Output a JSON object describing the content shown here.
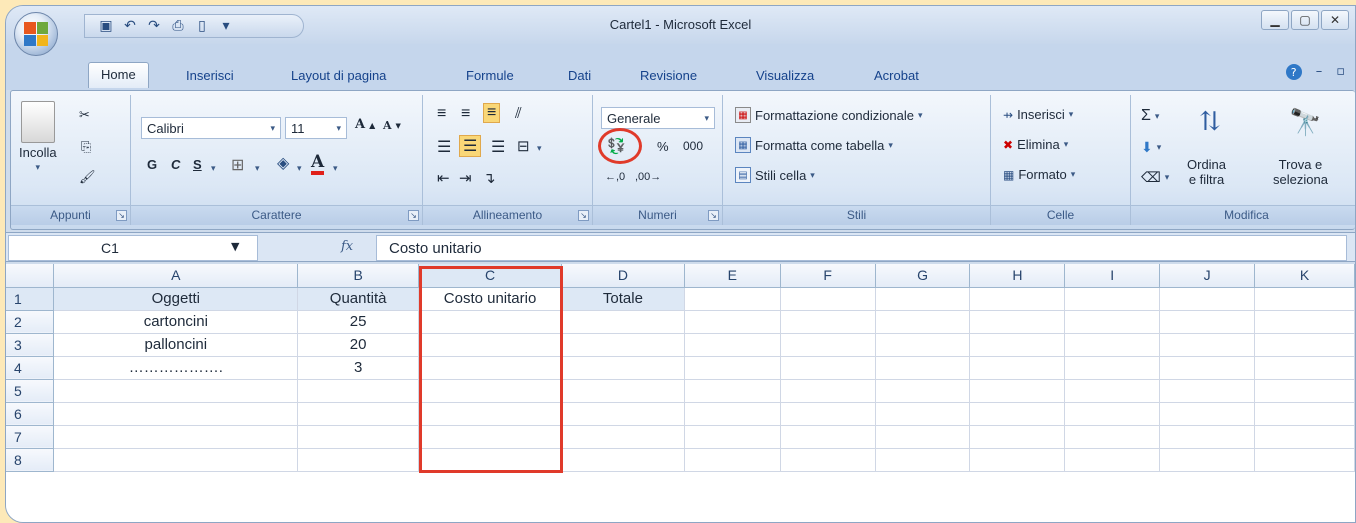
{
  "window": {
    "title": "Cartel1 - Microsoft Excel"
  },
  "tabs": [
    "Home",
    "Inserisci",
    "Layout di pagina",
    "Formule",
    "Dati",
    "Revisione",
    "Visualizza",
    "Acrobat"
  ],
  "active_tab": "Home",
  "ribbon": {
    "clipboard": {
      "label": "Appunti",
      "paste": "Incolla"
    },
    "font": {
      "label": "Carattere",
      "font_name": "Calibri",
      "font_size": "11",
      "bold": "G",
      "italic": "C",
      "underline": "S"
    },
    "alignment": {
      "label": "Allineamento"
    },
    "number": {
      "label": "Numeri",
      "format": "Generale",
      "percent": "%",
      "thousands": "000"
    },
    "styles": {
      "label": "Stili",
      "conditional": "Formattazione condizionale",
      "as_table": "Formatta come tabella",
      "cell_styles": "Stili cella"
    },
    "cells": {
      "label": "Celle",
      "insert": "Inserisci",
      "delete": "Elimina",
      "format": "Formato"
    },
    "editing": {
      "label": "Modifica",
      "sort": "Ordina",
      "sort2": "e filtra",
      "find": "Trova e",
      "find2": "seleziona"
    }
  },
  "formula_bar": {
    "name_box": "C1",
    "fx": "fx",
    "formula": "Costo unitario"
  },
  "sheet": {
    "columns": [
      "A",
      "B",
      "C",
      "D",
      "E",
      "F",
      "G",
      "H",
      "I",
      "J",
      "K"
    ],
    "rows": [
      {
        "n": "1",
        "cells": [
          "Oggetti",
          "Quantità",
          "Costo unitario",
          "Totale"
        ]
      },
      {
        "n": "2",
        "cells": [
          "cartoncini",
          "25",
          "",
          ""
        ]
      },
      {
        "n": "3",
        "cells": [
          "palloncini",
          "20",
          "",
          ""
        ]
      },
      {
        "n": "4",
        "cells": [
          "……………….",
          "3",
          "",
          ""
        ]
      },
      {
        "n": "5",
        "cells": [
          "",
          "",
          "",
          ""
        ]
      },
      {
        "n": "6",
        "cells": [
          "",
          "",
          "",
          ""
        ]
      },
      {
        "n": "7",
        "cells": [
          "",
          "",
          "",
          ""
        ]
      },
      {
        "n": "8",
        "cells": [
          "",
          "",
          "",
          ""
        ]
      }
    ]
  },
  "colors": {
    "annotation": "#e03a2a",
    "header_highlight": "#dde8f5"
  }
}
